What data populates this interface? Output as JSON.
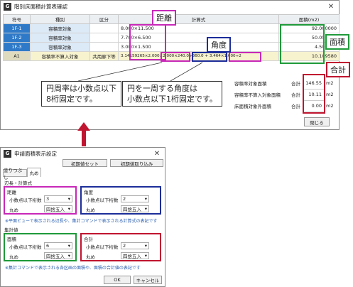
{
  "table_window": {
    "title": "階別床面積計算表確認",
    "icon_letter": "G",
    "columns": [
      "符号",
      "種別",
      "区分",
      "計算式",
      "面積(m2)"
    ],
    "rows": [
      {
        "code": "1F-1",
        "type": "容積率対象",
        "class": "",
        "formula": "8.000×11.500",
        "area": "92.000000"
      },
      {
        "code": "1F-2",
        "type": "容積率対象",
        "class": "",
        "formula": "7.700×6.500",
        "area": "50.050000"
      },
      {
        "code": "1F-3",
        "type": "容積率対象",
        "class": "",
        "formula": "3.000×1.500",
        "area": "4.500000"
      },
      {
        "code": "A1",
        "type": "容積率不算入対象",
        "class": "共用廊下等",
        "formula": "3.14159265×2.000×2.000×240.0÷360.0 + 3.464×1.000÷2",
        "area": "10.109580"
      }
    ],
    "summary": [
      {
        "label": "容積率対象面積",
        "col": "合計",
        "value": "146.55",
        "unit": "m2"
      },
      {
        "label": "容積率不算入対象面積",
        "col": "合計",
        "value": "10.11",
        "unit": "m2"
      },
      {
        "label": "床面積対象外面積",
        "col": "合計",
        "value": "0.00",
        "unit": "m2"
      }
    ],
    "close_label": "閉じる"
  },
  "annotations": {
    "distance": "距離",
    "angle": "角度",
    "area": "面積",
    "total": "合計",
    "pi_note_l1": "円周率は小数点以下",
    "pi_note_l2": "8桁固定です。",
    "angle_note_l1": "円を一周する角度は",
    "angle_note_l2": "小数点以下1桁固定です。"
  },
  "settings_window": {
    "title": "申請面積表示設定",
    "icon_letter": "G",
    "init_set": "初期値セット",
    "init_load": "初期値取り込み",
    "tabs": [
      "塗りつぶし",
      "丸め"
    ],
    "section1": "辺長・計算式",
    "distance_group": {
      "title": "距離",
      "digits_label": "小数点以下桁数",
      "digits": "3",
      "round_label": "丸め",
      "round": "四捨五入"
    },
    "angle_group": {
      "title": "角度",
      "digits_label": "小数点以下桁数",
      "digits": "2",
      "round_label": "丸め",
      "round": "四捨五入"
    },
    "note1": "※平面ビューで表示される辺長や、集計コマンドで表示される計算式の表記です",
    "section2": "集計値",
    "area_group": {
      "title": "面積",
      "digits_label": "小数点以下桁数",
      "digits": "6",
      "round_label": "丸め",
      "round": "四捨五入"
    },
    "total_group": {
      "title": "合計",
      "digits_label": "小数点以下桁数",
      "digits": "2",
      "round_label": "丸め",
      "round": "四捨五入"
    },
    "note2": "※集計コマンドで表示される各区画の面積や、面積の合計値の表記です",
    "ok": "OK",
    "cancel": "キャンセル"
  },
  "colors": {
    "magenta": "#c828b8",
    "navy": "#1c2d9a",
    "green": "#1f9a3a",
    "red": "#c01530",
    "row_blue": "#2f7ac8",
    "arrow": "#c01530"
  }
}
